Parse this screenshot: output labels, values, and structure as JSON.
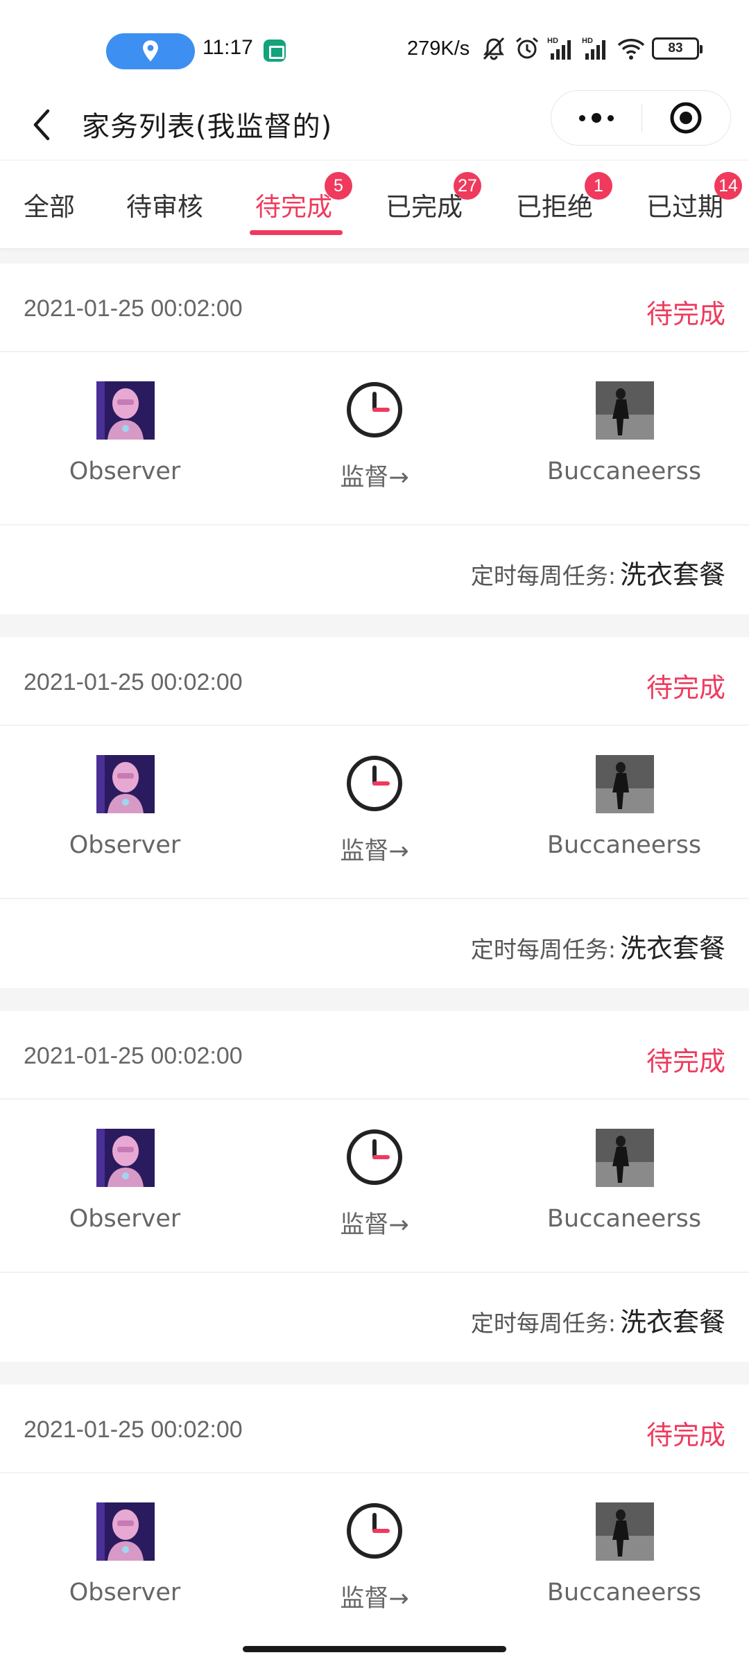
{
  "status_bar": {
    "time": "11:17",
    "net_speed": "279K/s",
    "battery": "83",
    "icons": [
      "location-icon",
      "app-book-icon",
      "mute-bell-icon",
      "alarm-icon",
      "signal-hd-1-icon",
      "signal-hd-2-icon",
      "wifi-icon",
      "battery-icon"
    ]
  },
  "nav": {
    "title": "家务列表(我监督的)",
    "back_icon": "back-chevron-icon",
    "more_icon": "more-dots-icon",
    "close_icon": "miniprogram-close-icon"
  },
  "tabs": [
    {
      "label": "全部",
      "badge": ""
    },
    {
      "label": "待审核",
      "badge": ""
    },
    {
      "label": "待完成",
      "badge": "5",
      "active": true
    },
    {
      "label": "已完成",
      "badge": "27"
    },
    {
      "label": "已拒绝",
      "badge": "1"
    },
    {
      "label": "已过期",
      "badge": "14"
    }
  ],
  "colors": {
    "accent": "#ef3a5d",
    "location_pill": "#3d8ff2"
  },
  "cards": [
    {
      "date": "2021-01-25 00:02:00",
      "status": "待完成",
      "supervisor": "Observer",
      "action": "监督→",
      "assignee": "Buccaneerss",
      "task_label": "定时每周任务:",
      "task_value": "洗衣套餐"
    },
    {
      "date": "2021-01-25 00:02:00",
      "status": "待完成",
      "supervisor": "Observer",
      "action": "监督→",
      "assignee": "Buccaneerss",
      "task_label": "定时每周任务:",
      "task_value": "洗衣套餐"
    },
    {
      "date": "2021-01-25 00:02:00",
      "status": "待完成",
      "supervisor": "Observer",
      "action": "监督→",
      "assignee": "Buccaneerss",
      "task_label": "定时每周任务:",
      "task_value": "洗衣套餐"
    },
    {
      "date": "2021-01-25 00:02:00",
      "status": "待完成",
      "supervisor": "Observer",
      "action": "监督→",
      "assignee": "Buccaneerss"
    }
  ]
}
